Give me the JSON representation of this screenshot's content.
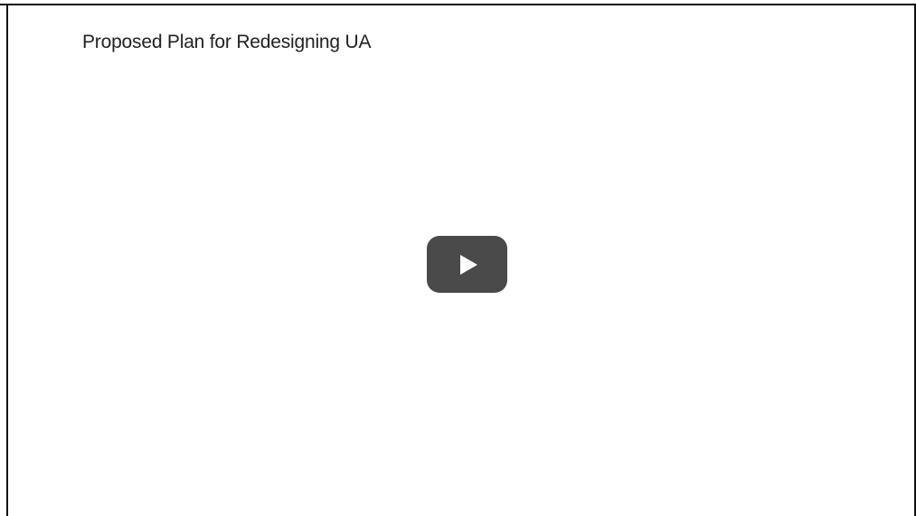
{
  "video": {
    "title": "Proposed Plan for Redesigning UA",
    "play_icon": "play-icon",
    "colors": {
      "play_button_bg": "#4a4a4a",
      "play_icon": "#ffffff",
      "title_text": "#222222",
      "frame_border": "#111111"
    }
  }
}
